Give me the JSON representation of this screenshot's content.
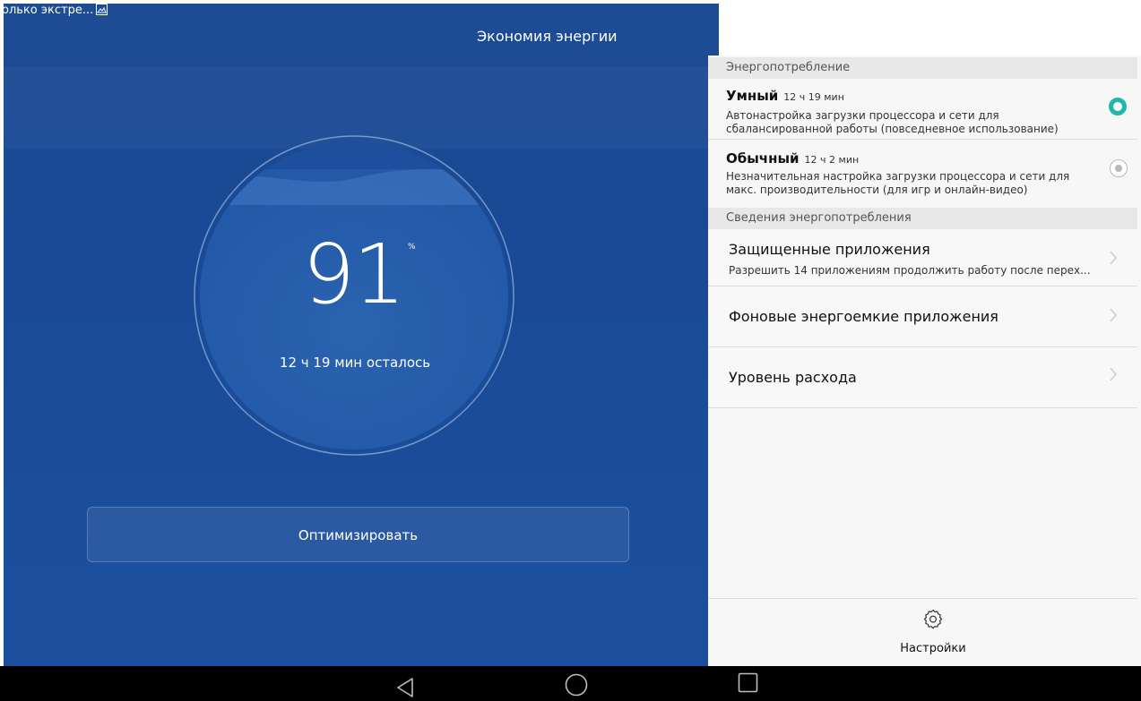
{
  "status_bar": {
    "notification_text": "олько экстре...",
    "notification_icon": "image-icon"
  },
  "app": {
    "title": "Экономия энергии"
  },
  "battery": {
    "percent": "91",
    "percent_sign": "%",
    "remaining": "12 ч 19 мин осталось",
    "level_fraction": 0.91
  },
  "optimize_button": {
    "label": "Оптимизировать"
  },
  "power_section": {
    "header": "Энергопотребление",
    "modes": [
      {
        "title": "Умный",
        "time": "12 ч 19 мин",
        "description": "Автонастройка загрузки процессора и сети для сбалансированной работы (повседневное использование)",
        "selected": true
      },
      {
        "title": "Обычный",
        "time": "12 ч 2 мин",
        "description": "Незначительная настройка загрузки процессора и сети для макс. производительности (для игр и онлайн-видео)",
        "selected": false
      }
    ]
  },
  "details_section": {
    "header": "Сведения энергопотребления",
    "items": [
      {
        "title": "Защищенные приложения",
        "subtitle": "Разрешить 14 приложениям продолжить работу после перех..."
      },
      {
        "title": "Фоновые энергоемкие приложения"
      },
      {
        "title": "Уровень расхода"
      }
    ]
  },
  "settings": {
    "label": "Настройки",
    "icon": "gear-icon"
  },
  "navigation": {
    "back_icon": "back-triangle-icon",
    "home_icon": "home-circle-icon",
    "recents_icon": "recents-square-icon"
  },
  "colors": {
    "background_blue": "#1a4a95",
    "accent_teal": "#1fb7a7",
    "panel_gray": "#f7f7f7"
  }
}
